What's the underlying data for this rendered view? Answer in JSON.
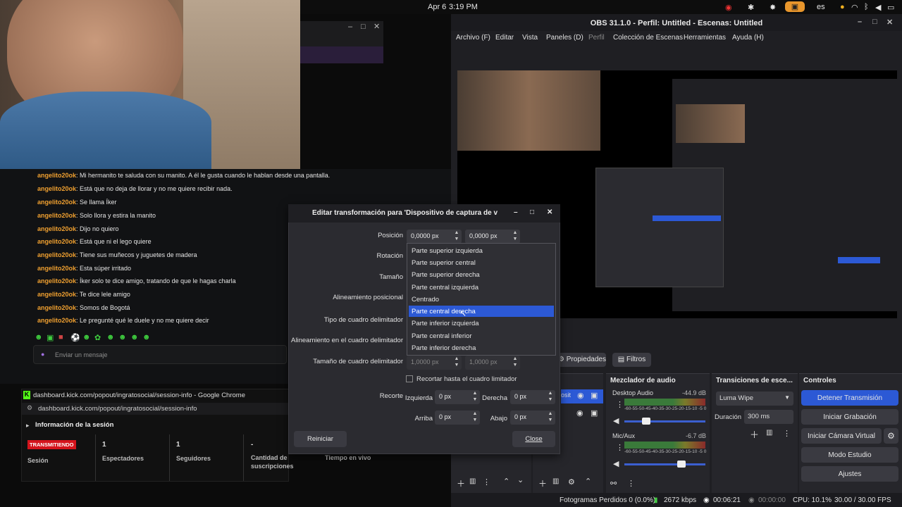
{
  "topbar": {
    "date": "Apr 6",
    "time": "3:19 PM",
    "lang": "es"
  },
  "chat": {
    "lines": [
      {
        "user": "angelito20ok",
        "msg": ": Mi hermanito te saluda con su manito. A él le gusta cuando le hablan desde una pantalla."
      },
      {
        "user": "angelito20ok",
        "msg": ": Está que no deja de llorar y no me quiere recibir nada."
      },
      {
        "user": "angelito20ok",
        "msg": ": Se llama Íker"
      },
      {
        "user": "angelito20ok",
        "msg": ": Solo llora y estira la manito"
      },
      {
        "user": "angelito20ok",
        "msg": ": Dijo no quiero"
      },
      {
        "user": "angelito20ok",
        "msg": ": Está que ni el lego quiere"
      },
      {
        "user": "angelito20ok",
        "msg": ": Tiene sus muñecos y juguetes de madera"
      },
      {
        "user": "angelito20ok",
        "msg": ": Esta súper irritado"
      },
      {
        "user": "angelito20ok",
        "msg": ": Íker solo te dice amigo, tratando de que le hagas charla"
      },
      {
        "user": "angelito20ok",
        "msg": ": Te dice lele amigo"
      },
      {
        "user": "angelito20ok",
        "msg": ": Somos de Bogotá"
      },
      {
        "user": "angelito20ok",
        "msg": ": Le pregunté qué le duele y no me quiere decir"
      }
    ],
    "input_placeholder": "Enviar un mensaje"
  },
  "chrome": {
    "title": "dashboard.kick.com/popout/ingratosocial/session-info - Google Chrome",
    "url": "dashboard.kick.com/popout/ingratosocial/session-info",
    "section": "Información de la sesión",
    "badge": "TRANSMITIENDO",
    "session_label": "Sesión",
    "stats": [
      {
        "value": "1",
        "label": "Espectadores"
      },
      {
        "value": "1",
        "label": "Seguidores"
      },
      {
        "value": "-",
        "label": "Cantidad de suscripciones"
      },
      {
        "value": "",
        "label": "Tiempo en vivo"
      }
    ]
  },
  "obs": {
    "title": "OBS 31.1.0 - Perfil: Untitled - Escenas: Untitled",
    "menu": [
      "Archivo (F)",
      "Editar",
      "Vista",
      "Paneles (D)",
      "Perfil",
      "Colección de Escenas",
      "Herramientas",
      "Ayuda (H)"
    ],
    "source_toolbar": {
      "properties": "Propiedades",
      "filters": "Filtros"
    },
    "mixer": {
      "title": "Mezclador de audio",
      "channels": [
        {
          "name": "Desktop Audio",
          "db": "-44.9 dB"
        },
        {
          "name": "Mic/Aux",
          "db": "-6.7 dB"
        }
      ],
      "scale": "-60-55-50-45-40-35-30-25-20-15-10 -5 0"
    },
    "transitions": {
      "title": "Transiciones de esce...",
      "selected": "Luma Wipe",
      "duration_label": "Duración",
      "duration": "300 ms"
    },
    "controls": {
      "title": "Controles",
      "buttons": [
        "Detener Transmisión",
        "Iniciar Grabación",
        "Iniciar Cámara Virtual",
        "Modo Estudio",
        "Ajustes"
      ]
    },
    "status": {
      "dropped": "Fotogramas Perdidos 0 (0.0%)",
      "bitrate": "2672 kbps",
      "live": "00:06:21",
      "rec": "00:00:00",
      "cpu": "CPU: 10.1%",
      "fps": "30.00 / 30.00 FPS"
    }
  },
  "dialog": {
    "title": "Editar transformación para 'Dispositivo de captura de v",
    "labels": {
      "position": "Posición",
      "rotation": "Rotación",
      "size": "Tamaño",
      "alignment": "Alineamiento posicional",
      "bbox_type": "Tipo de cuadro delimitador",
      "bbox_align": "Alineamiento en el cuadro delimitador",
      "bbox_size": "Tamaño de cuadro delimitador",
      "crop_bbox": "Recortar hasta el cuadro limitador",
      "crop": "Recorte",
      "left": "Izquierda",
      "right": "Derecha",
      "top": "Arriba",
      "bottom": "Abajo"
    },
    "values": {
      "pos_x": "0,0000 px",
      "pos_y": "0,0000 px",
      "bbox_w": "1,0000 px",
      "bbox_h": "1,0000 px",
      "crop_l": "0 px",
      "crop_r": "0 px",
      "crop_t": "0 px",
      "crop_b": "0 px"
    },
    "dropdown": [
      "Parte superior izquierda",
      "Parte superior central",
      "Parte superior derecha",
      "Parte central izquierda",
      "Centrado",
      "Parte central derecha",
      "Parte inferior izquierda",
      "Parte central inferior",
      "Parte inferior derecha"
    ],
    "selected_index": 5,
    "reset": "Reiniciar",
    "close": "Close"
  },
  "colors": {
    "accent": "#2c59d5",
    "username": "#f0a030",
    "live_badge": "#d4141c",
    "kick_green": "#53fc18"
  }
}
